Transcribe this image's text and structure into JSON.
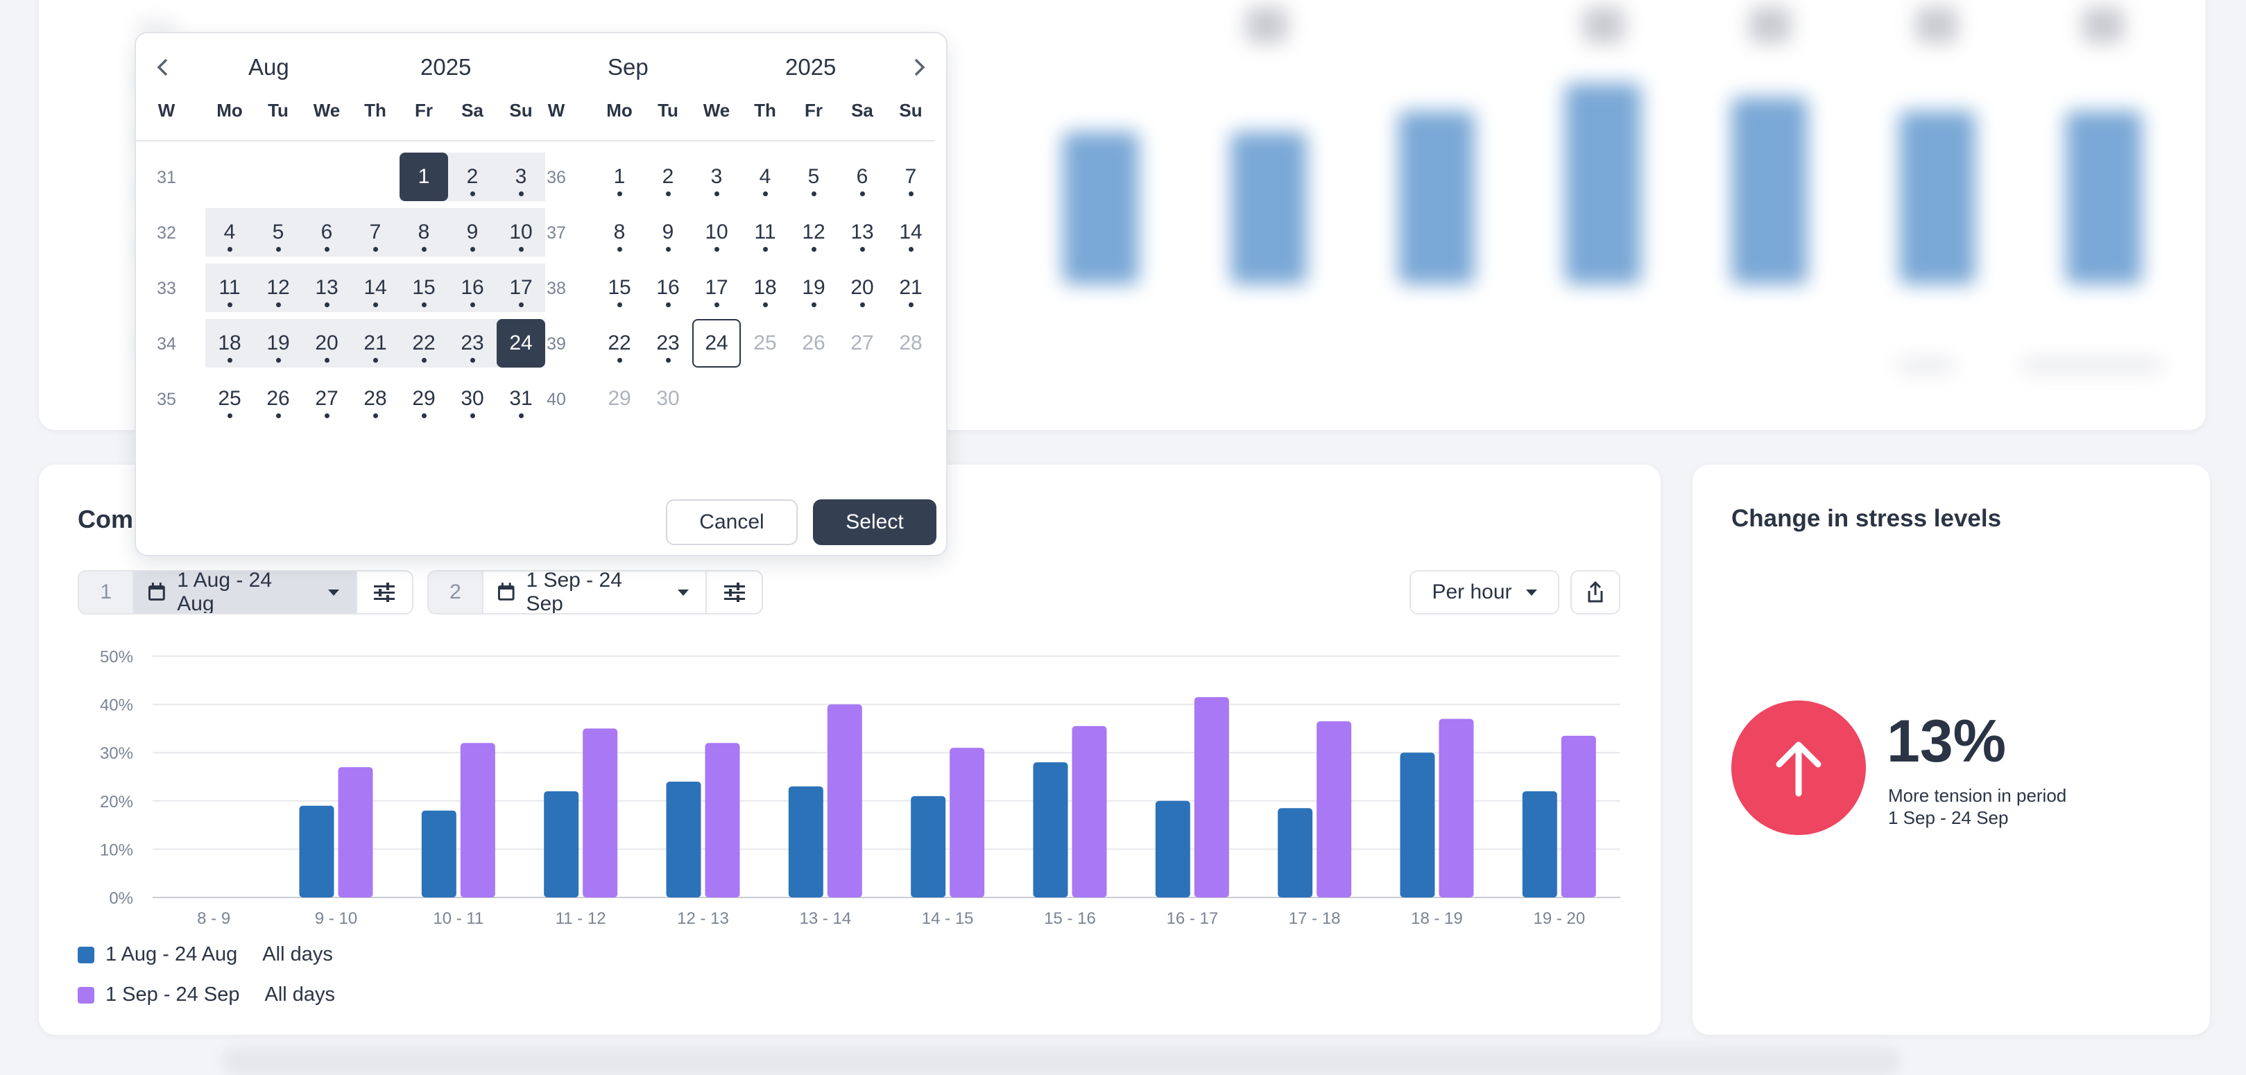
{
  "compare_card": {
    "title": "Com",
    "range1": {
      "num": "1",
      "label": "1 Aug - 24 Aug"
    },
    "range2": {
      "num": "2",
      "label": "1 Sep - 24 Sep"
    },
    "interval": "Per hour",
    "legend": [
      {
        "label": "1 Aug - 24 Aug",
        "filter": "All days",
        "color": "#2b72b9"
      },
      {
        "label": "1 Sep - 24 Sep",
        "filter": "All days",
        "color": "#a978f4"
      }
    ]
  },
  "chart_data": {
    "type": "bar",
    "categories": [
      "8 - 9",
      "9 - 10",
      "10 - 11",
      "11 - 12",
      "12 - 13",
      "13 - 14",
      "14 - 15",
      "15 - 16",
      "16 - 17",
      "17 - 18",
      "18 - 19",
      "19 - 20"
    ],
    "series": [
      {
        "name": "1 Aug - 24 Aug",
        "color": "#2b72b9",
        "values": [
          0,
          19,
          18,
          22,
          24,
          23,
          21,
          28,
          20,
          18.5,
          30,
          22
        ]
      },
      {
        "name": "1 Sep - 24 Sep",
        "color": "#a978f4",
        "values": [
          0,
          27,
          32,
          35,
          32,
          40,
          31,
          35.5,
          41.5,
          36.5,
          37,
          33.5
        ]
      }
    ],
    "yticks": [
      "0%",
      "10%",
      "20%",
      "30%",
      "40%",
      "50%"
    ],
    "ylim": [
      0,
      50
    ],
    "grid": true,
    "legend": "bottom-left"
  },
  "stress": {
    "title": "Change in stress levels",
    "value": "13%",
    "desc": "More tension in period",
    "period": "1 Sep - 24 Sep",
    "color": "#ee4560",
    "icon": "arrow-up-icon"
  },
  "picker": {
    "left": {
      "month": "Aug",
      "year": "2025",
      "weeks": [
        {
          "wk": "31",
          "days": [
            "",
            "",
            "",
            "",
            "1",
            "2",
            "3"
          ]
        },
        {
          "wk": "32",
          "days": [
            "4",
            "5",
            "6",
            "7",
            "8",
            "9",
            "10"
          ]
        },
        {
          "wk": "33",
          "days": [
            "11",
            "12",
            "13",
            "14",
            "15",
            "16",
            "17"
          ]
        },
        {
          "wk": "34",
          "days": [
            "18",
            "19",
            "20",
            "21",
            "22",
            "23",
            "24"
          ]
        },
        {
          "wk": "35",
          "days": [
            "25",
            "26",
            "27",
            "28",
            "29",
            "30",
            "31"
          ]
        }
      ]
    },
    "right": {
      "month": "Sep",
      "year": "2025",
      "weeks": [
        {
          "wk": "36",
          "days": [
            "1",
            "2",
            "3",
            "4",
            "5",
            "6",
            "7"
          ]
        },
        {
          "wk": "37",
          "days": [
            "8",
            "9",
            "10",
            "11",
            "12",
            "13",
            "14"
          ]
        },
        {
          "wk": "38",
          "days": [
            "15",
            "16",
            "17",
            "18",
            "19",
            "20",
            "21"
          ]
        },
        {
          "wk": "39",
          "days": [
            "22",
            "23",
            "24",
            "25",
            "26",
            "27",
            "28"
          ]
        },
        {
          "wk": "40",
          "days": [
            "29",
            "30",
            "",
            "",
            "",
            "",
            ""
          ]
        }
      ]
    },
    "weekday_headers": [
      "W",
      "Mo",
      "Tu",
      "We",
      "Th",
      "Fr",
      "Sa",
      "Su"
    ],
    "selected_start": "1 Aug",
    "selected_end": "24 Aug",
    "today": "24 Sep",
    "cancel": "Cancel",
    "select": "Select"
  }
}
